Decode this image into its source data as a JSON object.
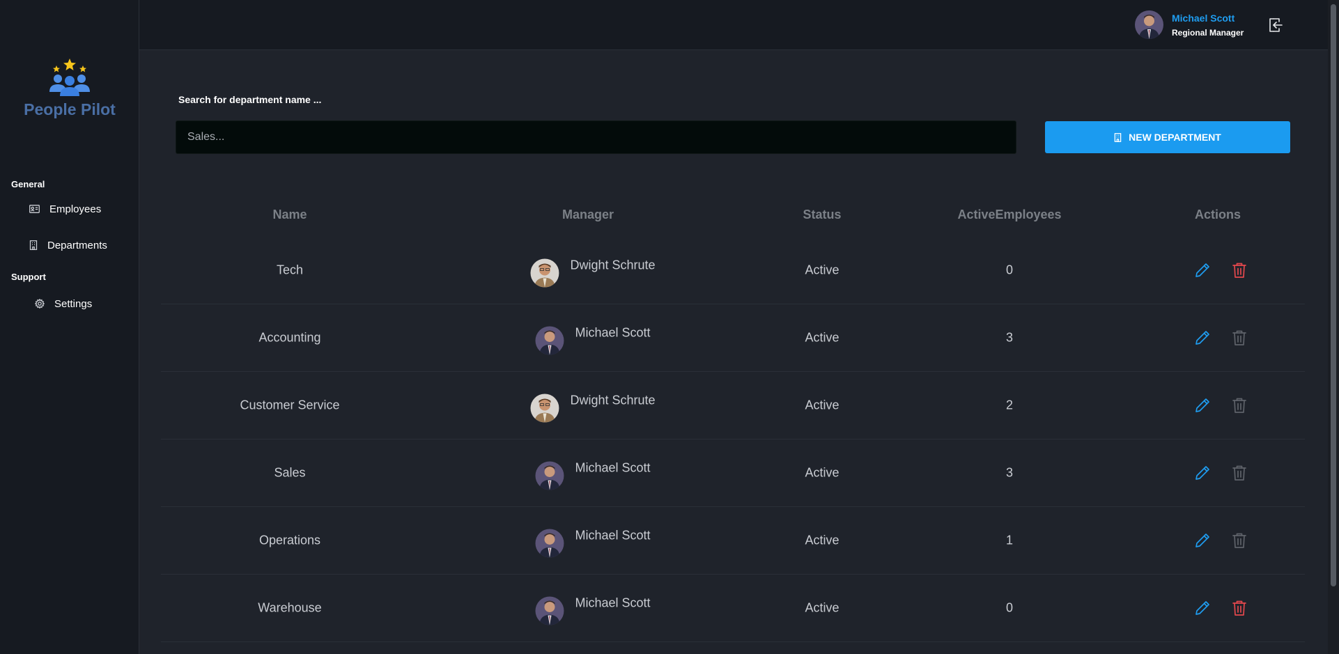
{
  "brand": {
    "name": "People Pilot"
  },
  "sidebar": {
    "sections": [
      {
        "heading": "General",
        "items": [
          {
            "label": "Employees",
            "icon": "id-card-icon"
          },
          {
            "label": "Departments",
            "icon": "building-icon"
          }
        ]
      },
      {
        "heading": "Support",
        "items": [
          {
            "label": "Settings",
            "icon": "gear-icon"
          }
        ]
      }
    ]
  },
  "user": {
    "name": "Michael Scott",
    "role": "Regional Manager"
  },
  "search": {
    "label": "Search for department name ...",
    "placeholder": "Sales..."
  },
  "new_department_label": "NEW DEPARTMENT",
  "table": {
    "headers": {
      "name": "Name",
      "manager": "Manager",
      "status": "Status",
      "active": "ActiveEmployees",
      "actions": "Actions"
    },
    "rows": [
      {
        "name": "Tech",
        "manager": "Dwight Schrute",
        "status": "Active",
        "active": "0",
        "delete_enabled": true
      },
      {
        "name": "Accounting",
        "manager": "Michael Scott",
        "status": "Active",
        "active": "3",
        "delete_enabled": false
      },
      {
        "name": "Customer Service",
        "manager": "Dwight Schrute",
        "status": "Active",
        "active": "2",
        "delete_enabled": false
      },
      {
        "name": "Sales",
        "manager": "Michael Scott",
        "status": "Active",
        "active": "3",
        "delete_enabled": false
      },
      {
        "name": "Operations",
        "manager": "Michael Scott",
        "status": "Active",
        "active": "1",
        "delete_enabled": false
      },
      {
        "name": "Warehouse",
        "manager": "Michael Scott",
        "status": "Active",
        "active": "0",
        "delete_enabled": true
      }
    ]
  },
  "colors": {
    "accent": "#1b9bf0",
    "delete_enabled": "#e5484d",
    "delete_disabled": "#5f636a",
    "sidebar_bg": "#161a21",
    "page_bg": "#1f232b"
  }
}
